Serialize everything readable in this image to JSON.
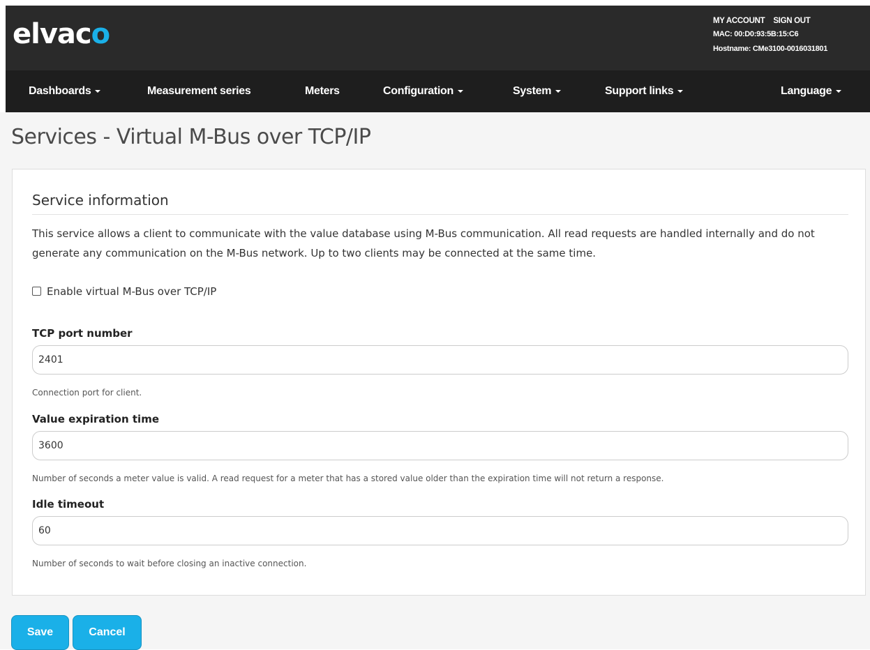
{
  "brand": {
    "logo_main": "elvac",
    "logo_accent": "o"
  },
  "account": {
    "my_account": "MY ACCOUNT",
    "sign_out": "SIGN OUT",
    "mac": "MAC: 00:D0:93:5B:15:C6",
    "hostname": "Hostname: CMe3100-0016031801"
  },
  "nav": {
    "dashboards": "Dashboards",
    "measurement_series": "Measurement series",
    "meters": "Meters",
    "configuration": "Configuration",
    "system": "System",
    "support_links": "Support links",
    "language": "Language"
  },
  "page": {
    "title": "Services - Virtual M-Bus over TCP/IP"
  },
  "service": {
    "section_title": "Service information",
    "description": "This service allows a client to communicate with the value database using M-Bus communication. All read requests are handled internally and do not generate any communication on the M-Bus network. Up to two clients may be connected at the same time.",
    "enable_label": "Enable virtual M-Bus over TCP/IP",
    "enabled": false
  },
  "fields": {
    "tcp_port": {
      "label": "TCP port number",
      "value": "2401",
      "help": "Connection port for client."
    },
    "value_expiration": {
      "label": "Value expiration time",
      "value": "3600",
      "help": "Number of seconds a meter value is valid. A read request for a meter that has a stored value older than the expiration time will not return a response."
    },
    "idle_timeout": {
      "label": "Idle timeout",
      "value": "60",
      "help": "Number of seconds to wait before closing an inactive connection."
    }
  },
  "actions": {
    "save": "Save",
    "cancel": "Cancel"
  },
  "colors": {
    "accent": "#1ab0e8",
    "header_bg": "#2a2a2a",
    "navbar_bg": "#1e1e1e",
    "page_bg": "#f5f5f5"
  }
}
